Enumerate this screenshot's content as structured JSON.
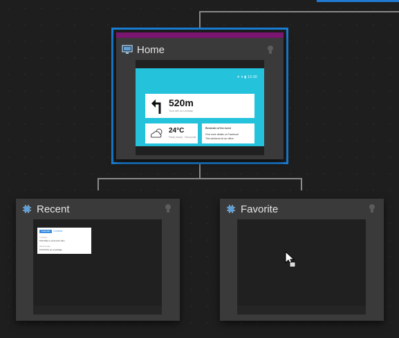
{
  "home": {
    "title": "Home",
    "screen_preview": {
      "status": "✈ ▾ ▮ 13:30",
      "navigation_distance": "520m",
      "navigation_sub": "Turn left on Leeway",
      "weather_temp": "24°C",
      "weather_sub": "Partly cloudy · Sunnyvale",
      "message_title": "Reminder of the event",
      "message_lines": [
        "Find more details on Facebook",
        "This weekend at our office"
      ]
    }
  },
  "recent": {
    "title": "Recent",
    "tile": {
      "badge": "Calendar",
      "tag": "3 events",
      "lines": [
        "Tuesday",
        "9:00 Ride to work with John",
        "Wednesday",
        "10:00 Pick up a package"
      ]
    }
  },
  "favorite": {
    "title": "Favorite"
  },
  "icons": {
    "home_icon": "monitor-icon",
    "section_icon": "device-chip-icon",
    "hint": "lightbulb-icon",
    "pointer": "hand-cursor-icon"
  },
  "colors": {
    "selection": "#1a7fd6",
    "home_strip": "#7a1570",
    "screen_background": "#25c2dc"
  }
}
